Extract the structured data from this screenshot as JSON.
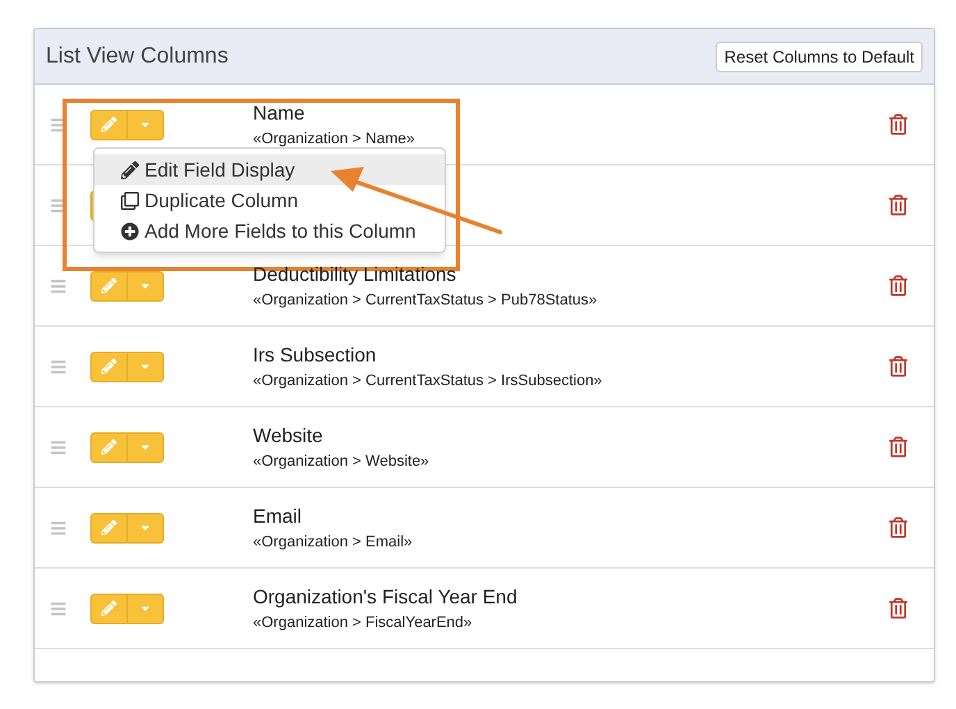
{
  "panel": {
    "title": "List View Columns",
    "reset_button": "Reset Columns to Default"
  },
  "columns": [
    {
      "kind": "field",
      "title": "Name",
      "path": "«Organization > Name»"
    },
    {
      "kind": "covered"
    },
    {
      "kind": "field",
      "title": "Deductibility Limitations",
      "path": "«Organization > CurrentTaxStatus > Pub78Status»"
    },
    {
      "kind": "field",
      "title": "Irs Subsection",
      "path": "«Organization > CurrentTaxStatus > IrsSubsection»"
    },
    {
      "kind": "field",
      "title": "Website",
      "path": "«Organization > Website»"
    },
    {
      "kind": "field",
      "title": "Email",
      "path": "«Organization > Email»"
    },
    {
      "kind": "field",
      "title": "Organization's Fiscal Year End",
      "path": "«Organization > FiscalYearEnd»"
    }
  ],
  "dropdown_menu": {
    "items": [
      {
        "kind": "edit",
        "label": "Edit Field Display",
        "selected": true
      },
      {
        "kind": "duplicate",
        "label": "Duplicate Column",
        "selected": false
      },
      {
        "kind": "add",
        "label": "Add More Fields to this Column",
        "selected": false
      }
    ]
  }
}
